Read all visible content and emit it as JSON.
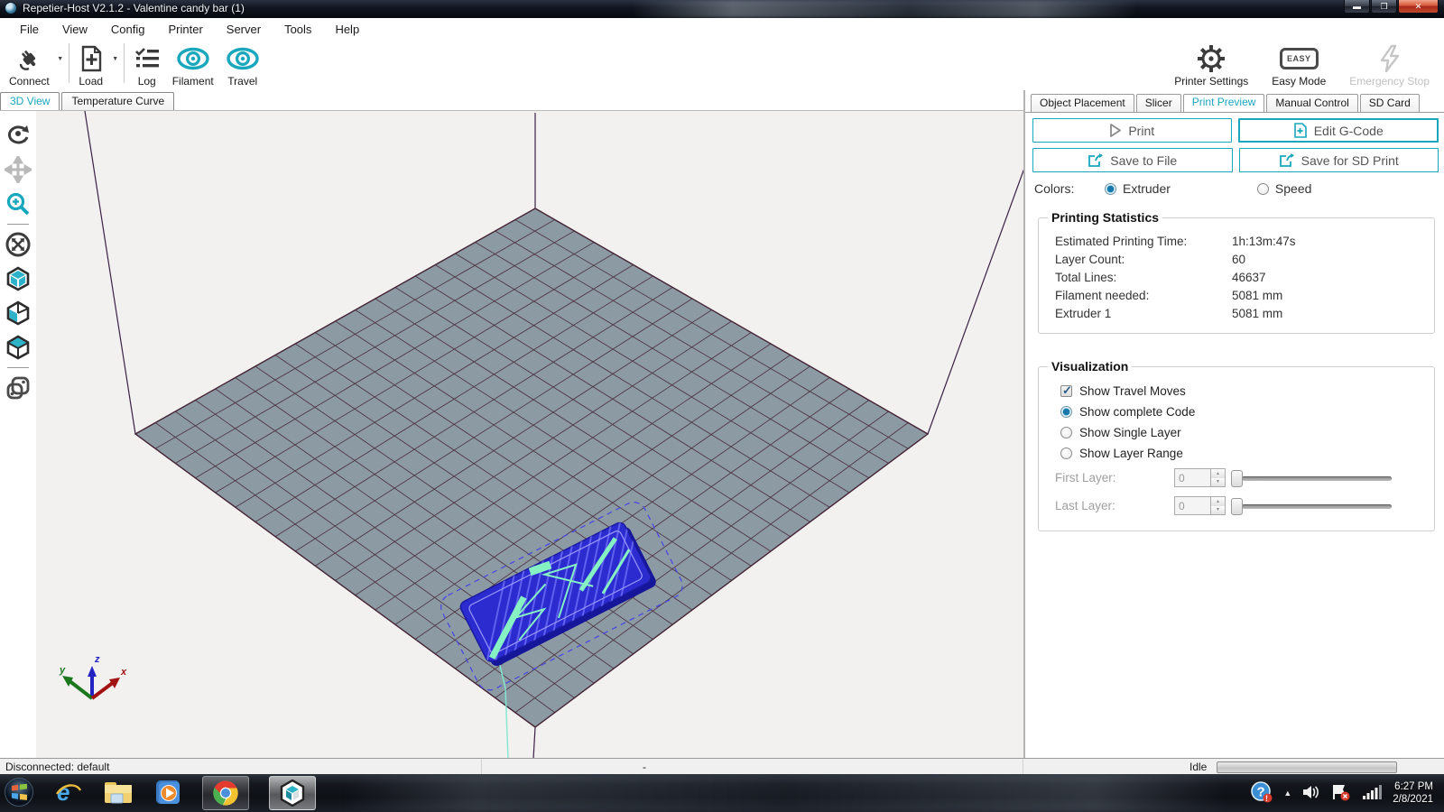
{
  "window": {
    "title": "Repetier-Host V2.1.2 - Valentine candy bar (1)"
  },
  "menu": {
    "items": [
      "File",
      "View",
      "Config",
      "Printer",
      "Server",
      "Tools",
      "Help"
    ]
  },
  "toolbar": {
    "connect": "Connect",
    "load": "Load",
    "log": "Log",
    "filament": "Filament",
    "travel": "Travel",
    "printer_settings": "Printer Settings",
    "easy_mode": "Easy Mode",
    "easy_badge": "EASY",
    "emergency_stop": "Emergency Stop"
  },
  "view_tabs": {
    "tab_3d": "3D View",
    "tab_temp": "Temperature Curve"
  },
  "axes": {
    "x": "x",
    "y": "y",
    "z": "z"
  },
  "right_panel": {
    "tabs": [
      "Object Placement",
      "Slicer",
      "Print Preview",
      "Manual Control",
      "SD Card"
    ],
    "buttons": {
      "print": "Print",
      "edit_gcode": "Edit G-Code",
      "save_file": "Save to File",
      "save_sd": "Save for SD Print"
    },
    "colors": {
      "label": "Colors:",
      "extruder": "Extruder",
      "speed": "Speed"
    },
    "stats": {
      "title": "Printing Statistics",
      "rows": [
        {
          "label": "Estimated Printing Time:",
          "value": "1h:13m:47s"
        },
        {
          "label": "Layer Count:",
          "value": "60"
        },
        {
          "label": "Total Lines:",
          "value": "46637"
        },
        {
          "label": "Filament needed:",
          "value": "5081 mm"
        },
        {
          "label": "Extruder 1",
          "value": "5081 mm"
        }
      ]
    },
    "visualization": {
      "title": "Visualization",
      "show_travel": "Show Travel Moves",
      "show_complete": "Show complete Code",
      "show_single": "Show Single Layer",
      "show_range": "Show Layer Range",
      "first_layer": "First Layer:",
      "last_layer": "Last Layer:",
      "first_value": "0",
      "last_value": "0"
    }
  },
  "status_bar": {
    "left": "Disconnected: default",
    "center": "-",
    "state": "Idle"
  },
  "taskbar": {
    "clock_time": "6:27 PM",
    "clock_date": "2/8/2021"
  },
  "theme": {
    "accent": "#18a7bd",
    "bed_fill": "#8c9ba3",
    "grid_line": "#452536"
  }
}
